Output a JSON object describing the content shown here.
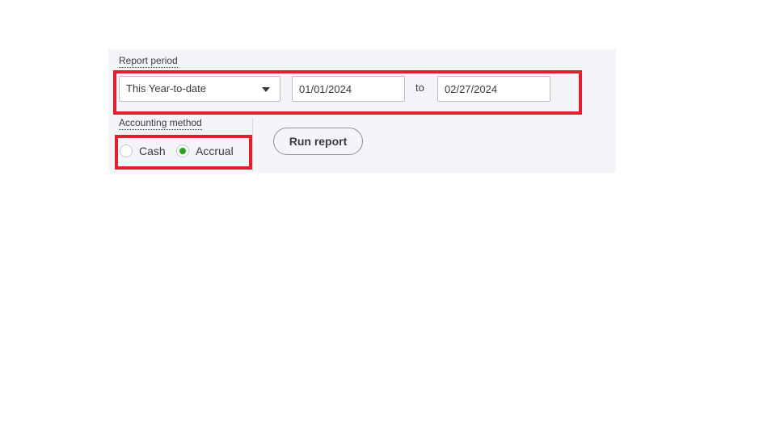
{
  "report_period": {
    "label": "Report period",
    "selected_option": "This Year-to-date",
    "from_date": "01/01/2024",
    "to_label": "to",
    "to_date": "02/27/2024"
  },
  "accounting_method": {
    "label": "Accounting method",
    "options": [
      {
        "label": "Cash",
        "checked": false
      },
      {
        "label": "Accrual",
        "checked": true
      }
    ]
  },
  "actions": {
    "run_report_label": "Run report"
  },
  "colors": {
    "highlight": "#e0202e",
    "radio_selected": "#2ca01c",
    "panel_background": "#f4f5f8"
  },
  "icons": {
    "dropdown": "caret-down-icon"
  }
}
